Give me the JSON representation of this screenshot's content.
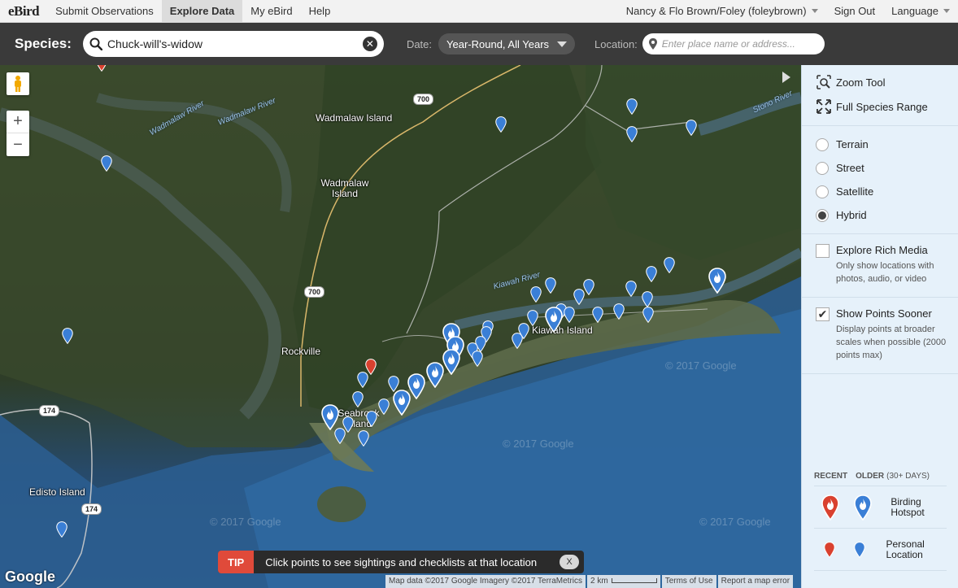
{
  "nav": {
    "logo": "eBird",
    "items": [
      "Submit Observations",
      "Explore Data",
      "My eBird",
      "Help"
    ],
    "active": "Explore Data",
    "user": "Nancy & Flo Brown/Foley (foleybrown)",
    "sign_out": "Sign Out",
    "language": "Language"
  },
  "search": {
    "species_label": "Species:",
    "species_value": "Chuck-will's-widow",
    "date_label": "Date:",
    "date_value": "Year-Round, All Years",
    "location_label": "Location:",
    "location_placeholder": "Enter place name or address..."
  },
  "map": {
    "labels": {
      "wadmalaw_island_1": "Wadmalaw Island",
      "wadmalaw_island_2": "Wadmalaw Island",
      "rockville": "Rockville",
      "seabrook_island": "Seabrook Island",
      "kiawah_island": "Kiawah Island",
      "edisto_island": "Edisto Island"
    },
    "rivers": {
      "wadmalaw_river_1": "Wadmalaw River",
      "wadmalaw_river_2": "Wadmalaw River",
      "kiawah_river": "Kiawah River",
      "stono_river": "Stono River"
    },
    "roads": {
      "r700a": "700",
      "r700b": "700",
      "r174a": "174",
      "r174b": "174"
    },
    "watermark": "© 2017 Google",
    "google": "Google",
    "attribution": {
      "data": "Map data ©2017 Google Imagery ©2017 TerraMetrics",
      "scale": "2 km",
      "terms": "Terms of Use",
      "report": "Report a map error"
    },
    "tip": {
      "badge": "TIP",
      "text": "Click points to see sightings and checklists at that location",
      "close": "X"
    },
    "marker_colors": {
      "older": "#3a7fd6",
      "recent": "#d9412f"
    }
  },
  "sidebar": {
    "tools": [
      "Zoom Tool",
      "Full Species Range"
    ],
    "map_types": [
      "Terrain",
      "Street",
      "Satellite",
      "Hybrid"
    ],
    "selected_map_type": "Hybrid",
    "rich_media": {
      "title": "Explore Rich Media",
      "desc": "Only show locations with photos, audio, or video",
      "checked": false
    },
    "points_sooner": {
      "title": "Show Points Sooner",
      "desc": "Display points at broader scales when possible (2000 points max)",
      "checked": true
    },
    "legend": {
      "recent": "RECENT",
      "older": "OLDER",
      "older_sub": "(30+ DAYS)",
      "hotspot": "Birding Hotspot",
      "personal": "Personal Location"
    }
  }
}
